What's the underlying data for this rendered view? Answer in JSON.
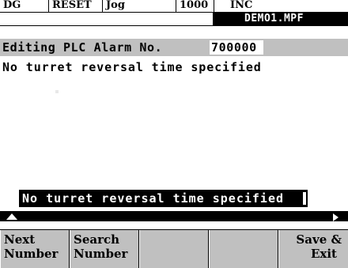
{
  "status_bar": {
    "area": "DG",
    "channel_state": "RESET",
    "mode": "Jog",
    "feed": "1000",
    "increment": "INC"
  },
  "program": {
    "file_name": "DEMO1.MPF"
  },
  "editor": {
    "label": "Editing PLC Alarm No.",
    "alarm_number": "700000",
    "alarm_text": "No turret reversal time specified",
    "input_value": "No turret reversal time specified"
  },
  "softkeys": [
    {
      "line1": "Next",
      "line2": "Number"
    },
    {
      "line1": "Search",
      "line2": "Number"
    },
    {
      "line1": "",
      "line2": ""
    },
    {
      "line1": "",
      "line2": ""
    },
    {
      "line1": "Save &",
      "line2": "Exit"
    }
  ],
  "icons": {
    "scroll_up": "arrow-up-icon",
    "scroll_right": "arrow-right-icon"
  },
  "colors": {
    "background": "#ffffff",
    "highlight": "#c0c0c0",
    "inverse": "#000000"
  }
}
